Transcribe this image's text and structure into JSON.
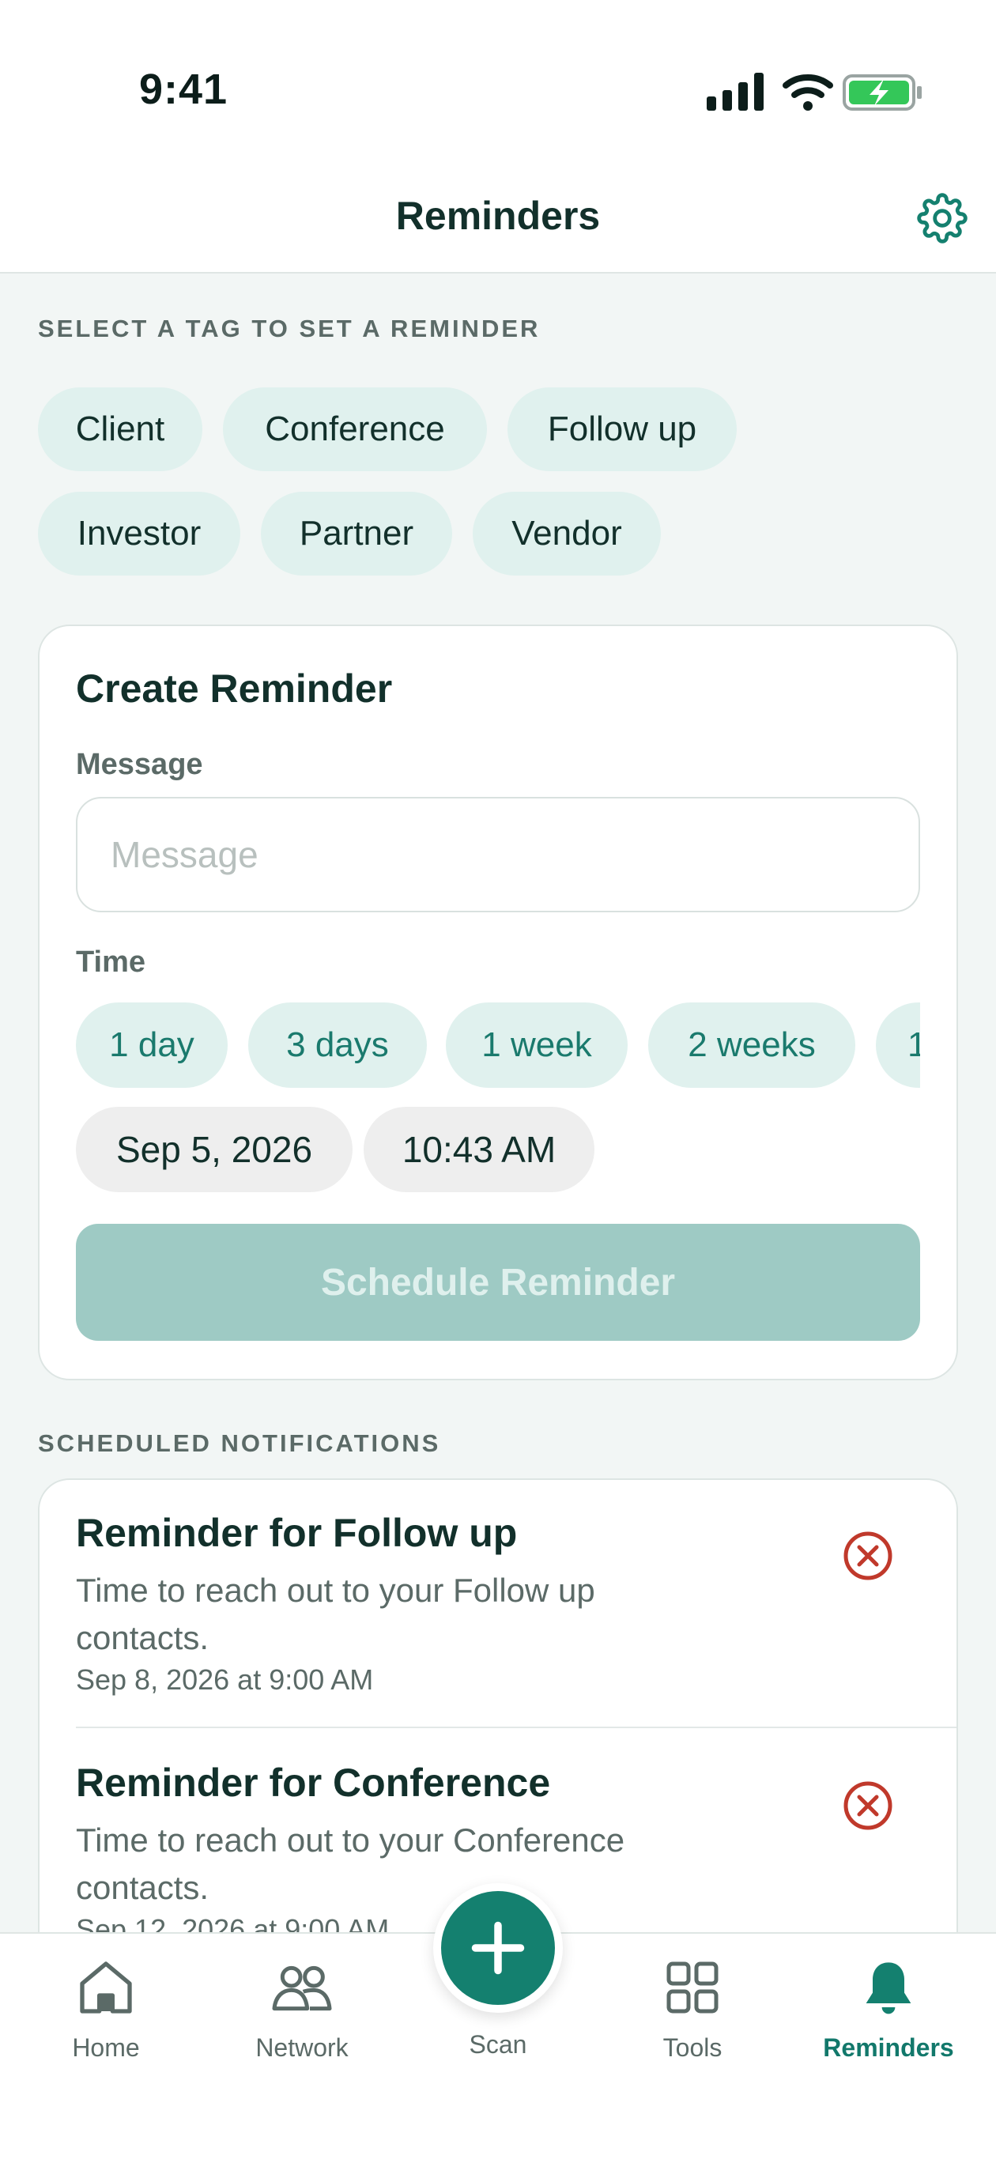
{
  "status_bar": {
    "time": "9:41"
  },
  "header": {
    "title": "Reminders"
  },
  "tags_section": {
    "label": "SELECT A TAG TO SET A REMINDER",
    "tags": [
      "Client",
      "Conference",
      "Follow up",
      "Investor",
      "Partner",
      "Vendor"
    ]
  },
  "create_card": {
    "title": "Create Reminder",
    "message_label": "Message",
    "message_value": "",
    "message_placeholder": "Message",
    "time_label": "Time",
    "time_options": [
      "1 day",
      "3 days",
      "1 week",
      "2 weeks",
      "1"
    ],
    "date_value": "Sep 5, 2026",
    "time_value": "10:43 AM",
    "schedule_label": "Schedule Reminder"
  },
  "scheduled": {
    "label": "SCHEDULED NOTIFICATIONS",
    "items": [
      {
        "title": "Reminder for Follow up",
        "body": "Time to reach out to your Follow up contacts.",
        "date": "Sep 8, 2026 at 9:00 AM"
      },
      {
        "title": "Reminder for Conference",
        "body": "Time to reach out to your Conference contacts.",
        "date": "Sep 12, 2026 at 9:00 AM"
      }
    ]
  },
  "tabbar": {
    "home": "Home",
    "network": "Network",
    "scan": "Scan",
    "tools": "Tools",
    "reminders": "Reminders"
  },
  "colors": {
    "accent": "#14806f",
    "chip_bg": "#e0f1ee",
    "delete": "#c0392b",
    "battery": "#34c759"
  }
}
